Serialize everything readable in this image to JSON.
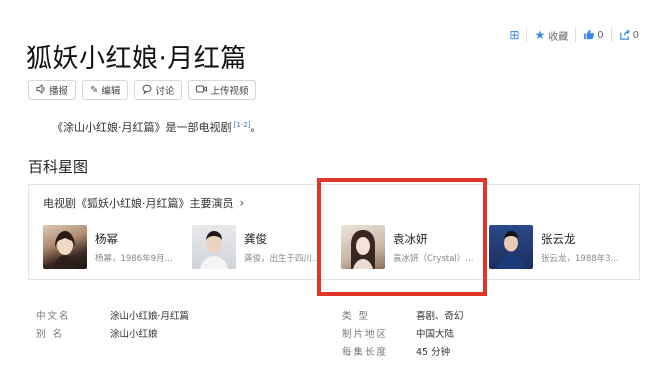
{
  "header": {
    "title": "狐妖小红娘·月红篇",
    "actions": {
      "collect_label": "收藏",
      "like_count": "0",
      "share_count": "0"
    },
    "toolbar": [
      {
        "label": "播报",
        "icon": "speaker-icon"
      },
      {
        "label": "编辑",
        "icon": "pencil-icon"
      },
      {
        "label": "讨论",
        "icon": "comment-icon"
      },
      {
        "label": "上传视频",
        "icon": "video-icon"
      }
    ]
  },
  "summary": {
    "text": "《涂山小红娘·月红篇》是一部电视剧",
    "ref": "[1-2]",
    "end": "。"
  },
  "star_map": {
    "section_title": "百科星图",
    "heading": "电视剧《狐妖小红娘·月红篇》主要演员",
    "cast": [
      {
        "name": "杨幂",
        "desc": "杨幂，1986年9月..."
      },
      {
        "name": "龚俊",
        "desc": "龚俊，出生于四川..."
      },
      {
        "name": "袁冰妍",
        "desc": "袁冰妍（Crystal）..."
      },
      {
        "name": "张云龙",
        "desc": "张云龙，1988年3..."
      }
    ]
  },
  "info_left": [
    {
      "key": "中文名",
      "value": "涂山小红娘·月红篇"
    },
    {
      "key": "别 名",
      "value": "涂山小红娘"
    }
  ],
  "info_right": [
    {
      "key": "类 型",
      "value": "喜剧、奇幻"
    },
    {
      "key": "制片地区",
      "value": "中国大陆"
    },
    {
      "key": "每集长度",
      "value": "45 分钟"
    }
  ],
  "colors": {
    "highlight": "#e0362a",
    "accent": "#3a87ee"
  }
}
